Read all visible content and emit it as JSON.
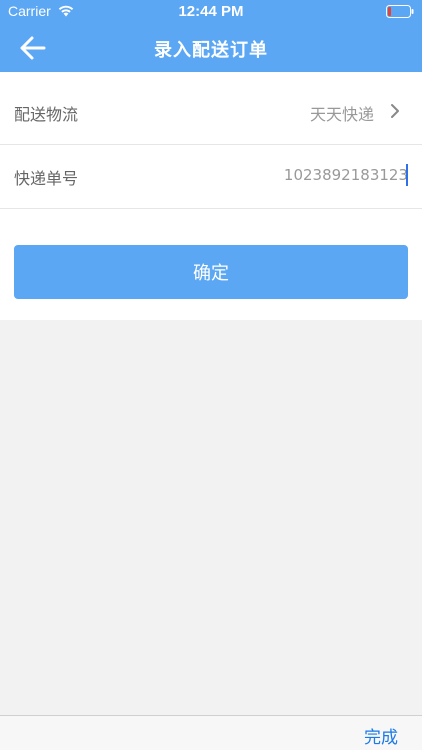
{
  "status_bar": {
    "carrier": "Carrier",
    "time": "12:44 PM",
    "battery_color": "#e0453c"
  },
  "nav": {
    "title": "录入配送订单",
    "back_icon": "arrow-left-icon"
  },
  "form": {
    "logistics_label": "配送物流",
    "logistics_value": "天天快递",
    "tracking_label": "快递单号",
    "tracking_value": "1023892183123"
  },
  "confirm_label": "确定",
  "keyboard_accessory": {
    "done_label": "完成"
  },
  "colors": {
    "accent": "#5ba7f4",
    "link": "#1a7ae8",
    "background": "#f2f2f2"
  }
}
